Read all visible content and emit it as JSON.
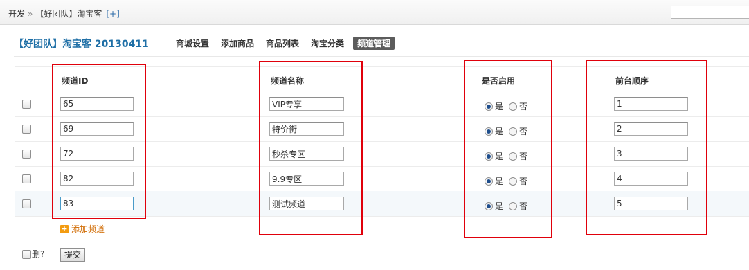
{
  "breadcrumb": {
    "root": "开发",
    "sep": "»",
    "current": "【好团队】淘宝客",
    "add": "[+]"
  },
  "header": {
    "title": "【好团队】淘宝客 20130411",
    "tabs": [
      "商城设置",
      "添加商品",
      "商品列表",
      "淘宝分类",
      "频道管理"
    ],
    "active_tab": "频道管理"
  },
  "table": {
    "columns": {
      "id": "频道ID",
      "name": "频道名称",
      "enabled": "是否启用",
      "order": "前台顺序"
    },
    "radio_yes": "是",
    "radio_no": "否",
    "rows": [
      {
        "id": "65",
        "name": "VIP专享",
        "enabled": "是",
        "order": "1"
      },
      {
        "id": "69",
        "name": "特价街",
        "enabled": "是",
        "order": "2"
      },
      {
        "id": "72",
        "name": "秒杀专区",
        "enabled": "是",
        "order": "3"
      },
      {
        "id": "82",
        "name": "9.9专区",
        "enabled": "是",
        "order": "4"
      },
      {
        "id": "83",
        "name": "测试频道",
        "enabled": "是",
        "order": "5"
      }
    ]
  },
  "actions": {
    "add_channel": "添加频道",
    "delete_label": "删?",
    "submit": "提交"
  }
}
